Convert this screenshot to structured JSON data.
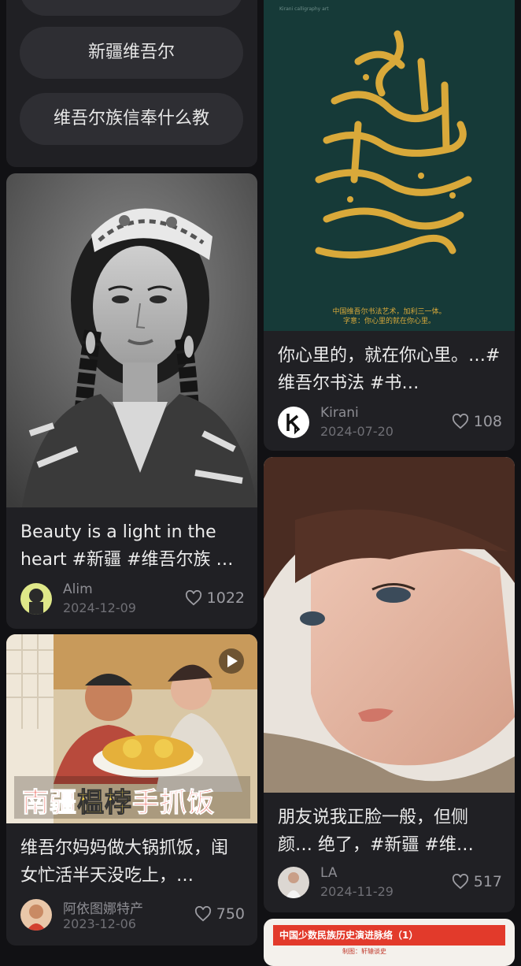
{
  "suggestions": {
    "items": [
      {
        "label": "新疆维吾尔"
      },
      {
        "label": "维吾尔族信奉什么教"
      }
    ]
  },
  "feed": {
    "cards": [
      {
        "title": "Beauty is a light in the heart #新疆 #维吾尔族 …",
        "author": "Alim",
        "date": "2024-12-09",
        "likes": "1022",
        "image": "woman-doppa-photo"
      },
      {
        "title": "你心里的，就在你心里。…#维吾尔书法 #书…",
        "author": "Kirani",
        "date": "2024-07-20",
        "likes": "108",
        "image": "calligraphy-poster",
        "image_caption_1": "中国维吾尔书法艺术，加利三一体。",
        "image_caption_2": "字意：你心里的就在你心里。",
        "image_tiny": "Kirani calligraphy art"
      },
      {
        "title": "维吾尔妈妈做大锅抓饭，闺女忙活半天没吃上，…",
        "author": "阿依图娜特产",
        "date": "2023-12-06",
        "likes": "750",
        "image": "video-thumbnail",
        "overlay_a": "南疆",
        "overlay_b": "榅桲",
        "overlay_c": "手抓饭"
      },
      {
        "title": "朋友说我正脸一般，但侧颜… 绝了，#新疆 #维…",
        "author": "LA",
        "date": "2024-11-29",
        "likes": "517",
        "image": "portrait-photo"
      },
      {
        "title": "中国少数民族历史演进脉络（1）",
        "subtitle": "制图：轩辕谈史"
      }
    ]
  },
  "colors": {
    "background": "#111114",
    "card": "#202024",
    "pill": "#2e2e33",
    "calligraphy_bg": "#163a38",
    "gold": "#d9a93a",
    "overlay_red": "#e8392b",
    "overlay_yellow": "#f6d24b"
  }
}
